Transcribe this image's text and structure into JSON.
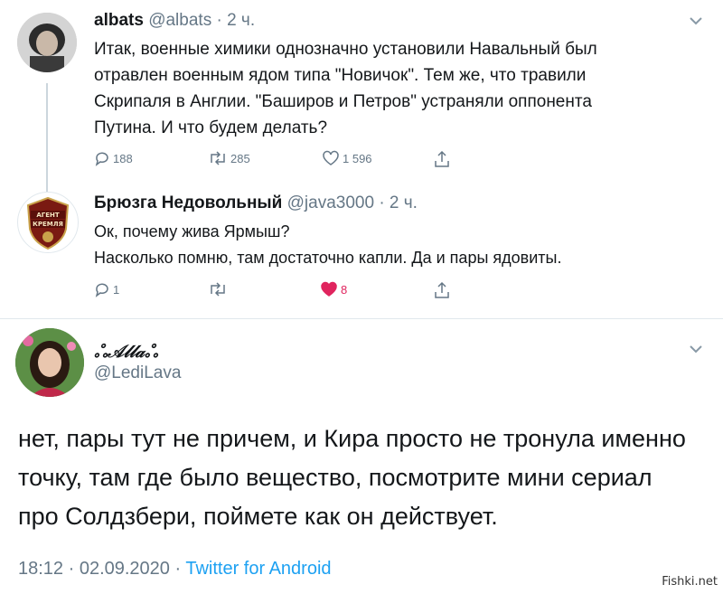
{
  "tweet1": {
    "name": "albats",
    "handle": "@albats",
    "time": "· 2 ч.",
    "lines": [
      "Итак, военные химики однозначно установили Навальный был",
      "отравлен военным ядом типа \"Новичок\". Тем же, что травили",
      "Скрипаля в Англии. \"Баширов и Петров\" устраняли оппонента",
      "Путина. И что будем делать?"
    ],
    "replies": "188",
    "retweets": "285",
    "likes": "1 596"
  },
  "tweet2": {
    "name": "Брюзга Недовольный",
    "handle": "@java3000",
    "time": "· 2 ч.",
    "lines": [
      "Ок, почему жива Ярмыш?",
      "Насколько помню, там достаточно капли. Да и пары ядовиты."
    ],
    "replies": "1",
    "retweets": "",
    "likes": "8",
    "liked_color": "#e0245e",
    "avatar_badge_top": "АГЕНТ",
    "avatar_badge_bottom": "КРЕМЛЯ"
  },
  "tweet3": {
    "name": "ஃ𝒜𝓁𝓁𝒶ஃ",
    "handle": "@LediLava",
    "lines": [
      "нет, пары тут не причем, и Кира просто не тронула именно",
      "точку, там где было вещество, посмотрите мини  сериал",
      "про Солдзбери, поймете как он действует."
    ],
    "datetime": "18:12 · 02.09.2020 · ",
    "source": "Twitter for Android"
  },
  "watermark": "Fishki.net",
  "colors": {
    "accent": "#1da1f2",
    "secondary": "#657786",
    "like": "#e0245e"
  }
}
